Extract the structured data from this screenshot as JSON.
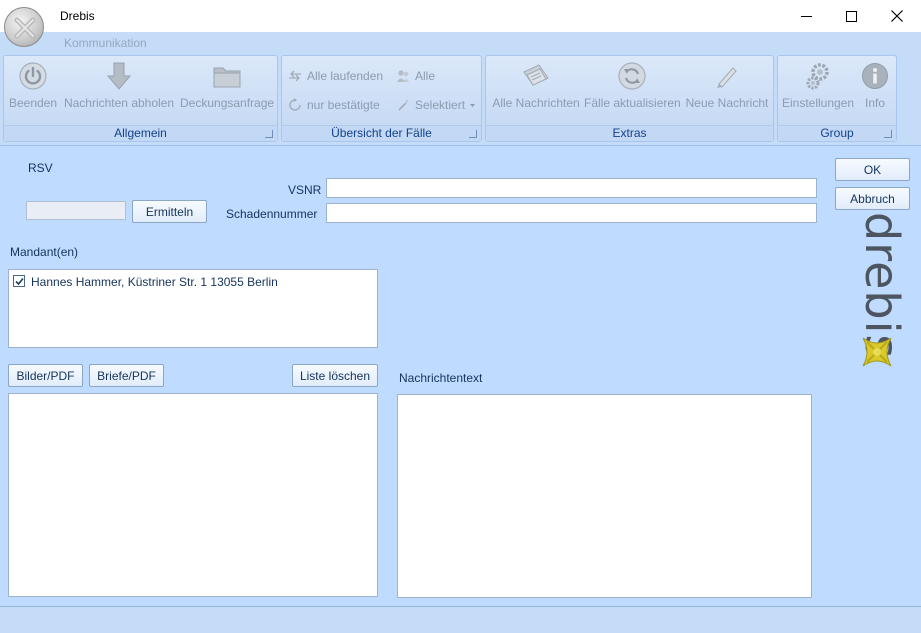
{
  "window": {
    "title": "Drebis"
  },
  "ribbon": {
    "tab": "Kommunikation",
    "groups": {
      "allgemein": {
        "label": "Allgemein",
        "buttons": [
          "Beenden",
          "Nachrichten abholen",
          "Deckungsanfrage"
        ]
      },
      "uebersicht": {
        "label": "Übersicht der Fälle",
        "buttons": [
          "Alle laufenden",
          "Alle",
          "nur bestätigte",
          "Selektiert"
        ]
      },
      "extras": {
        "label": "Extras",
        "buttons": [
          "Alle Nachrichten",
          "Fälle aktualisieren",
          "Neue Nachricht"
        ]
      },
      "group": {
        "label": "Group",
        "buttons": [
          "Einstellungen",
          "Info"
        ]
      }
    }
  },
  "form": {
    "rsv_label": "RSV",
    "ermitteln_button": "Ermitteln",
    "vsnr_label": "VSNR",
    "vsnr_value": "",
    "schadennummer_label": "Schadennummer",
    "schadennummer_value": "",
    "mandanten_label": "Mandant(en)",
    "mandanten": [
      {
        "text": "Hannes Hammer, Küstriner Str. 1 13055 Berlin",
        "checked": true
      }
    ],
    "bilder_button": "Bilder/PDF",
    "briefe_button": "Briefe/PDF",
    "liste_loeschen_button": "Liste löschen",
    "nachrichtentext_label": "Nachrichtentext",
    "ok_button": "OK",
    "abbruch_button": "Abbruch"
  },
  "brand": {
    "logo_text": "drebis"
  },
  "colors": {
    "background": "#bfdbff",
    "ribbon": "#c5dcf8",
    "disabled_text": "#8b9bb0",
    "group_label": "#15428b"
  }
}
